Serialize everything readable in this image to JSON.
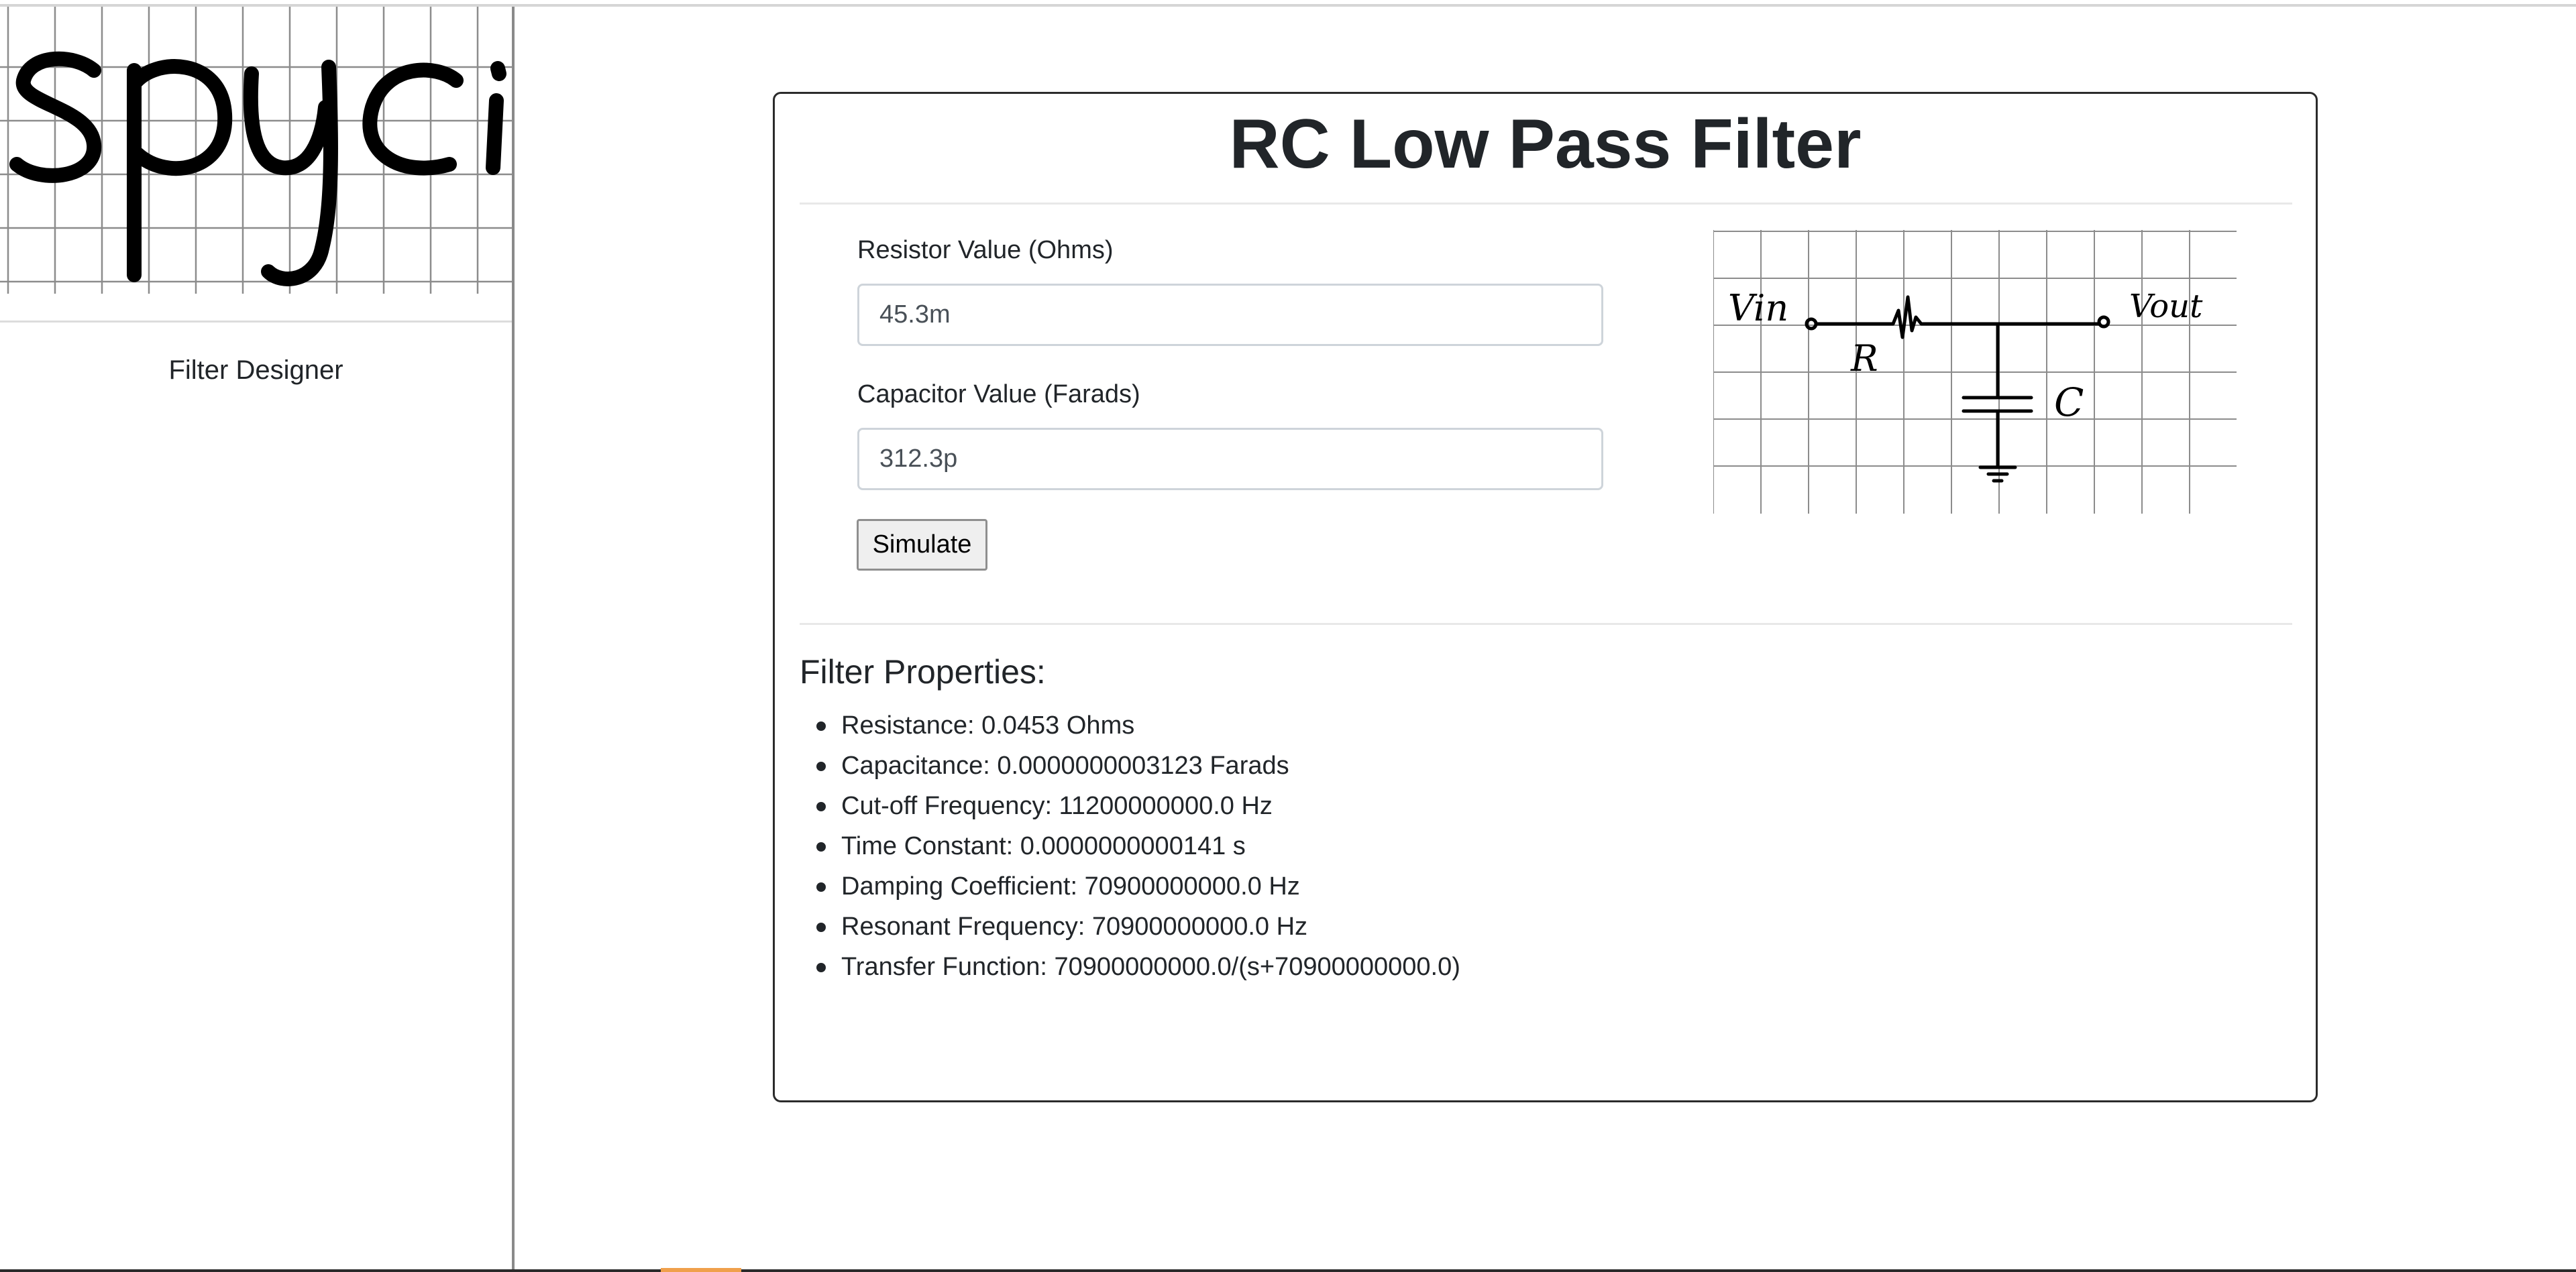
{
  "sidebar": {
    "logo_text": "spyci",
    "nav_items": [
      {
        "label": "Filter Designer"
      }
    ]
  },
  "main": {
    "title": "RC Low Pass Filter",
    "resistor": {
      "label": "Resistor Value (Ohms)",
      "value": "45.3m"
    },
    "capacitor": {
      "label": "Capacitor Value (Farads)",
      "value": "312.3p"
    },
    "simulate_label": "Simulate",
    "schematic": {
      "vin_label": "Vin",
      "vout_label": "Vout",
      "r_label": "R",
      "c_label": "C"
    },
    "properties": {
      "title": "Filter Properties:",
      "items": [
        {
          "text": "Resistance: 0.0453 Ohms"
        },
        {
          "text": "Capacitance: 0.0000000003123 Farads"
        },
        {
          "text": "Cut-off Frequency: 11200000000.0 Hz"
        },
        {
          "text": "Time Constant: 0.0000000000141 s"
        },
        {
          "text": "Damping Coefficient: 70900000000.0 Hz"
        },
        {
          "text": "Resonant Frequency: 70900000000.0 Hz"
        },
        {
          "text": "Transfer Function: 70900000000.0/(s+70900000000.0)"
        }
      ]
    }
  },
  "colors": {
    "text": "#212529",
    "border": "#2b2b2b",
    "grid": "#8c8c8c",
    "ink": "#000000"
  }
}
